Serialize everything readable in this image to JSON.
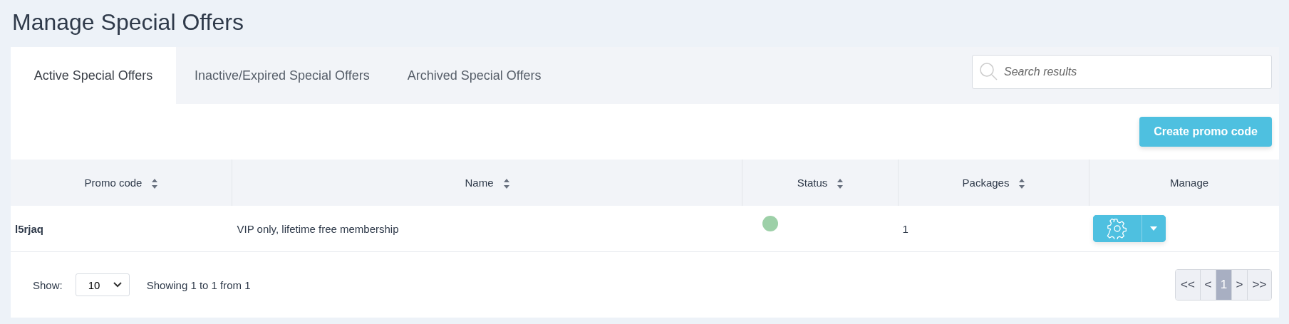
{
  "page_title": "Manage Special Offers",
  "tabs": [
    {
      "label": "Active Special Offers",
      "selected": true
    },
    {
      "label": "Inactive/Expired Special Offers",
      "selected": false
    },
    {
      "label": "Archived Special Offers",
      "selected": false
    }
  ],
  "search": {
    "placeholder": "Search results"
  },
  "create_button": "Create promo code",
  "table": {
    "columns": [
      {
        "label": "Promo code",
        "sortable": true
      },
      {
        "label": "Name",
        "sortable": true
      },
      {
        "label": "Status",
        "sortable": true
      },
      {
        "label": "Packages",
        "sortable": true
      },
      {
        "label": "Manage",
        "sortable": false
      }
    ],
    "rows": [
      {
        "promo_code": "l5rjaq",
        "name": "VIP only, lifetime free membership",
        "active": true,
        "packages": "1"
      }
    ]
  },
  "footer": {
    "show_label": "Show:",
    "page_size": "10",
    "summary": "Showing 1 to 1 from 1",
    "pagination": [
      {
        "label": "<<",
        "selected": false
      },
      {
        "label": "<",
        "selected": false
      },
      {
        "label": "1",
        "selected": true
      },
      {
        "label": ">",
        "selected": false
      },
      {
        "label": ">>",
        "selected": false
      }
    ]
  }
}
